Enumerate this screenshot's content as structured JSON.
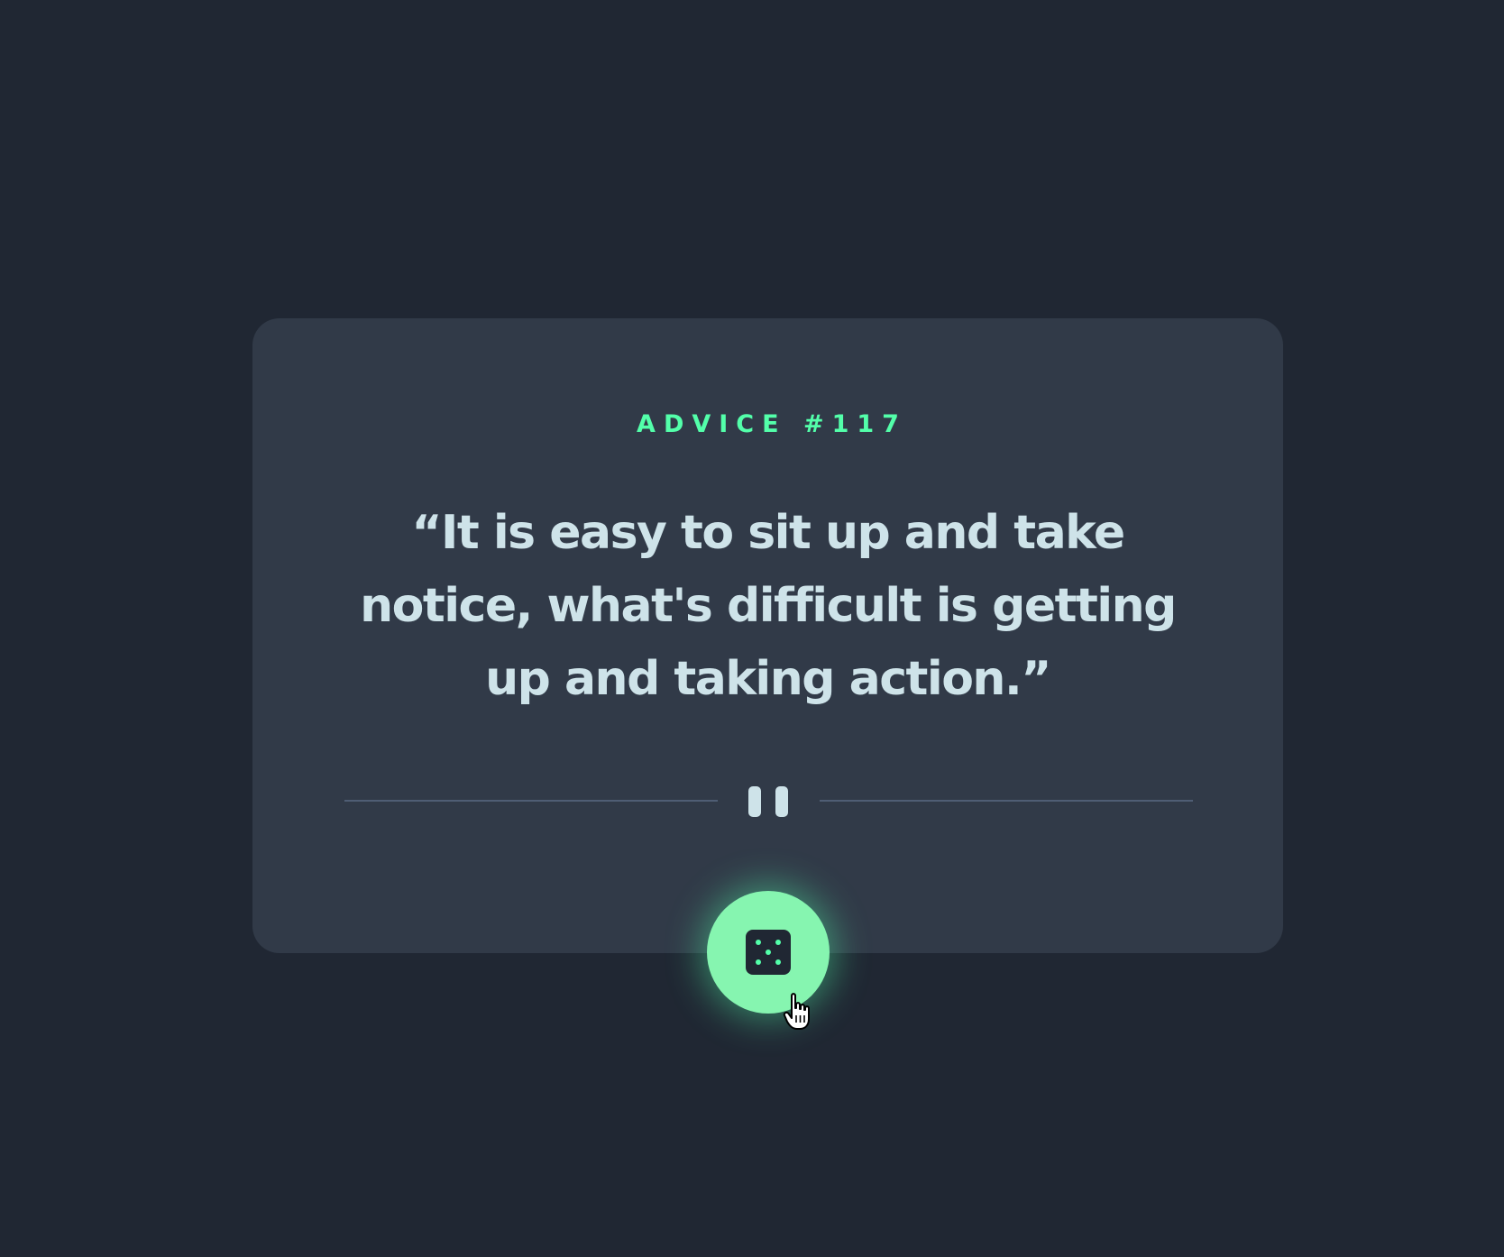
{
  "advice": {
    "label": "ADVICE #117",
    "quote": "“It is easy to sit up and take notice, what's difficult is getting up and taking action.”"
  },
  "colors": {
    "background": "#202733",
    "card": "#313a48",
    "accent": "#53ffaa",
    "text": "#cee3e9",
    "divider": "#4f5d74"
  },
  "icons": {
    "divider_icon": "pause-icon",
    "button_icon": "dice-icon",
    "cursor": "hand-pointer-icon"
  }
}
